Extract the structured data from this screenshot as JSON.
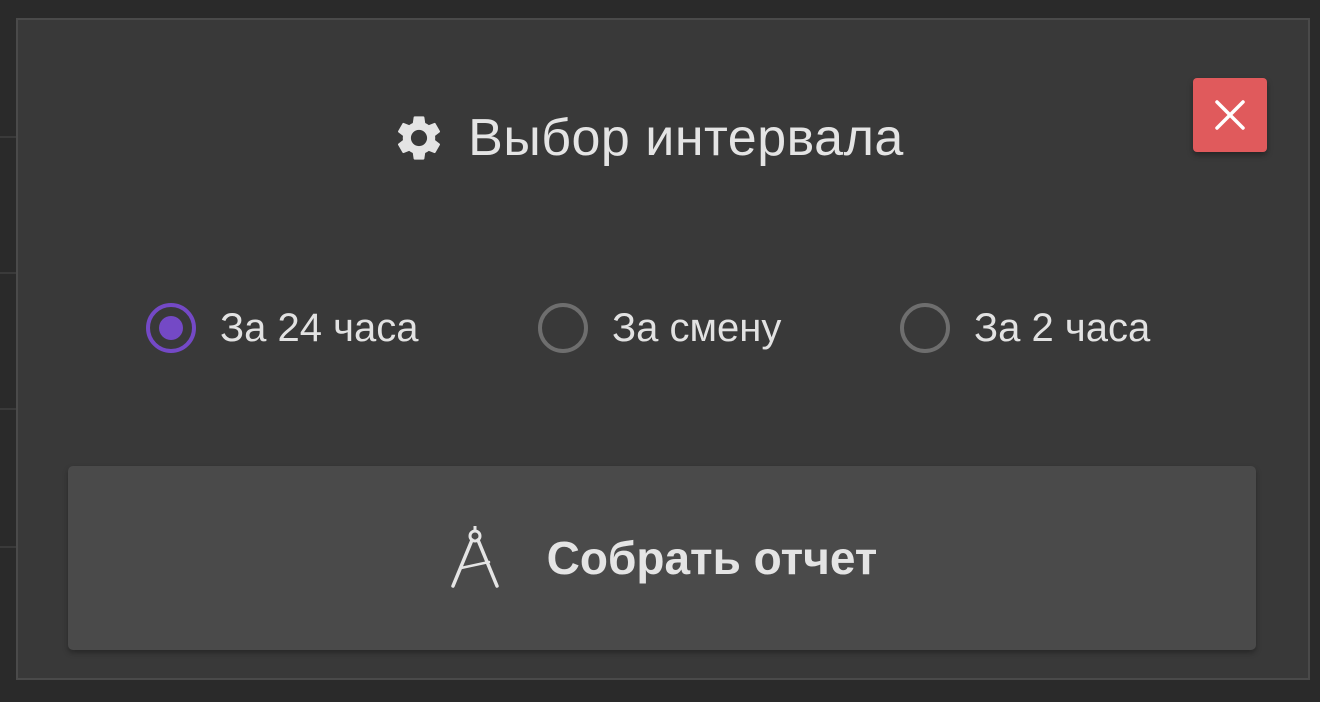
{
  "dialog": {
    "title": "Выбор интервала",
    "title_icon": "gear-icon",
    "close_icon": "close-icon",
    "close_color": "#e05a5c"
  },
  "interval_options": [
    {
      "label": "За 24 часа",
      "checked": true
    },
    {
      "label": "За смену",
      "checked": false
    },
    {
      "label": "За 2 часа",
      "checked": false
    }
  ],
  "action": {
    "label": "Собрать отчет",
    "icon": "compass-icon"
  },
  "colors": {
    "accent": "#7449c6",
    "dialog_bg": "#393939",
    "button_bg": "#4a4a4a",
    "text": "#e4e4e4"
  }
}
